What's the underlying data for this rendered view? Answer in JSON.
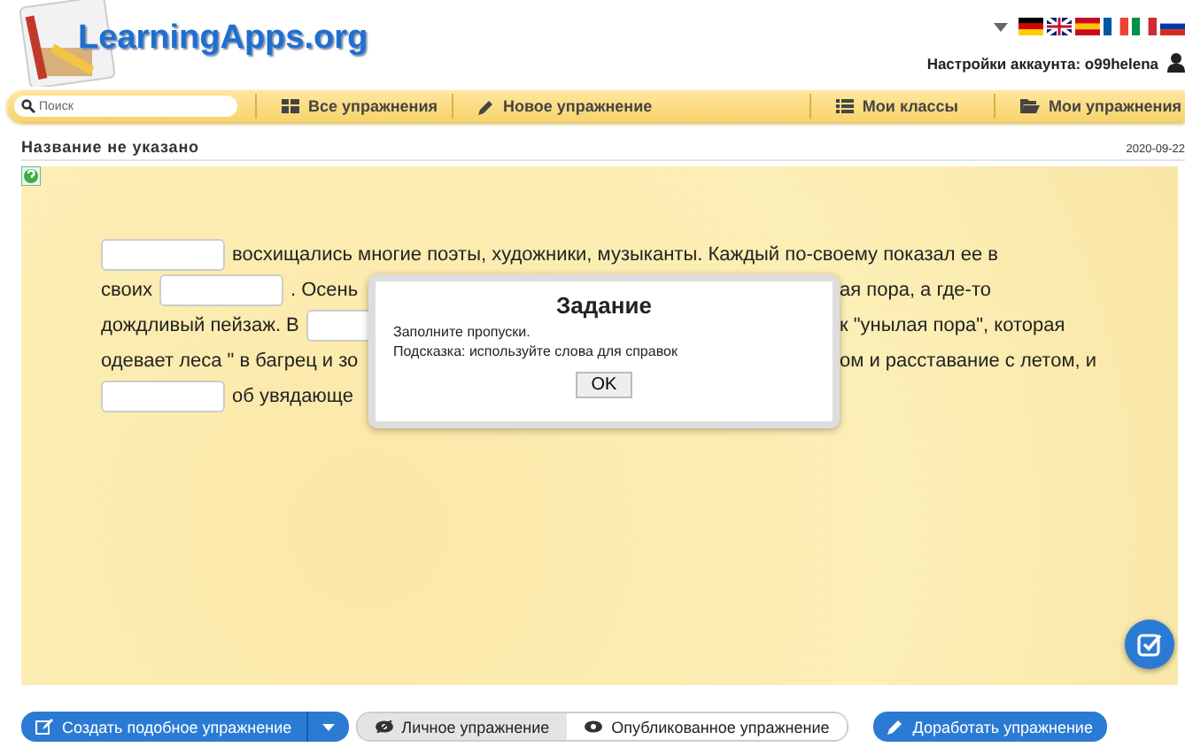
{
  "header": {
    "logo": "LearningApps.org",
    "account": "Настройки аккаунта: o99helena"
  },
  "nav": {
    "search": {
      "placeholder": "Поиск"
    },
    "items": [
      {
        "label": "Все упражнения"
      },
      {
        "label": "Новое упражнение"
      },
      {
        "label": "Мои классы"
      },
      {
        "label": "Мои упражнения"
      }
    ]
  },
  "app": {
    "title": "Название не указано",
    "date": "2020-09-22",
    "lines": [
      {
        "left": [
          {
            "kind": "blank"
          },
          {
            "kind": "text",
            "text": "восхищались многие поэты, художники, музыканты. Каждый по-своему показал ее в"
          }
        ]
      },
      {
        "left": [
          {
            "kind": "text",
            "text": "своих"
          },
          {
            "kind": "blank"
          },
          {
            "kind": "text",
            "text": ". Осень"
          }
        ],
        "right": [
          {
            "kind": "text",
            "text": "ая пора, а где-то"
          }
        ]
      },
      {
        "left": [
          {
            "kind": "text",
            "text": "дождливый пейзаж. В"
          },
          {
            "kind": "blank"
          }
        ],
        "right": [
          {
            "kind": "text",
            "text": "к \"унылая пора\", которая"
          }
        ]
      },
      {
        "left": [
          {
            "kind": "text",
            "text": "одевает леса \" в багрец и зо"
          }
        ],
        "right": [
          {
            "kind": "text",
            "text": "ом и расставание с летом, и"
          }
        ]
      },
      {
        "left": [
          {
            "kind": "blank"
          },
          {
            "kind": "text",
            "text": "об увядающе"
          }
        ]
      }
    ]
  },
  "dialog": {
    "title": "Задание",
    "lines": [
      "Заполните пропуски.",
      "Подсказка: используйте слова для справок"
    ],
    "button": "OK"
  },
  "footer": {
    "create": "Создать подобное упражнение",
    "toggle": [
      {
        "label": "Личное упражнение",
        "selected": true
      },
      {
        "label": "Опубликованное упражнение",
        "selected": false
      }
    ],
    "improve": "Доработать упражнение"
  }
}
